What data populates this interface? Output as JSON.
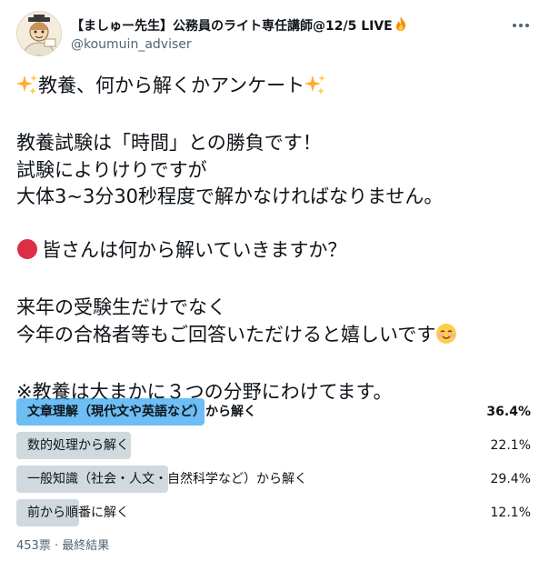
{
  "author": {
    "display_name": "【ましゅー先生】公務員のライト専任講師@12/5 LIVE",
    "handle": "@koumuin_adviser",
    "avatar_icon": "cartoon-teacher-avatar",
    "name_suffix_icon": "fire-icon"
  },
  "tweet": {
    "lines": [
      {
        "text": "教養、何から解くかアンケート",
        "prefix_icon": "sparkles-icon",
        "suffix_icon": "sparkles-icon"
      },
      {
        "text": ""
      },
      {
        "text": "教養試験は「時間」との勝負です！"
      },
      {
        "text": "試験によりけりですが"
      },
      {
        "text": "大体3~3分30秒程度で解かなければなりません。"
      },
      {
        "text": ""
      },
      {
        "text": "皆さんは何から解いていきますか？",
        "prefix_icon": "red-circle-icon"
      },
      {
        "text": ""
      },
      {
        "text": "来年の受験生だけでなく"
      },
      {
        "text": "今年の合格者等もご回答いただけると嬉しいです",
        "suffix_icon": "smiling-face-icon"
      },
      {
        "text": ""
      },
      {
        "text": "※教養は大まかに３つの分野にわけてます。"
      }
    ]
  },
  "poll": {
    "options": [
      {
        "label": "文章理解（現代文や英語など）から解く",
        "percent_label": "36.4%",
        "percent": 36.4,
        "winner": true
      },
      {
        "label": "数的処理から解く",
        "percent_label": "22.1%",
        "percent": 22.1,
        "winner": false
      },
      {
        "label": "一般知識（社会・人文・自然科学など）から解く",
        "percent_label": "29.4%",
        "percent": 29.4,
        "winner": false
      },
      {
        "label": "前から順番に解く",
        "percent_label": "12.1%",
        "percent": 12.1,
        "winner": false
      }
    ],
    "footer": "453票 · 最終結果"
  },
  "colors": {
    "winner_bar": "#1d9bf0",
    "other_bar": "#cfd9de",
    "secondary_text": "#536471"
  },
  "more_icon": "more-options-icon"
}
